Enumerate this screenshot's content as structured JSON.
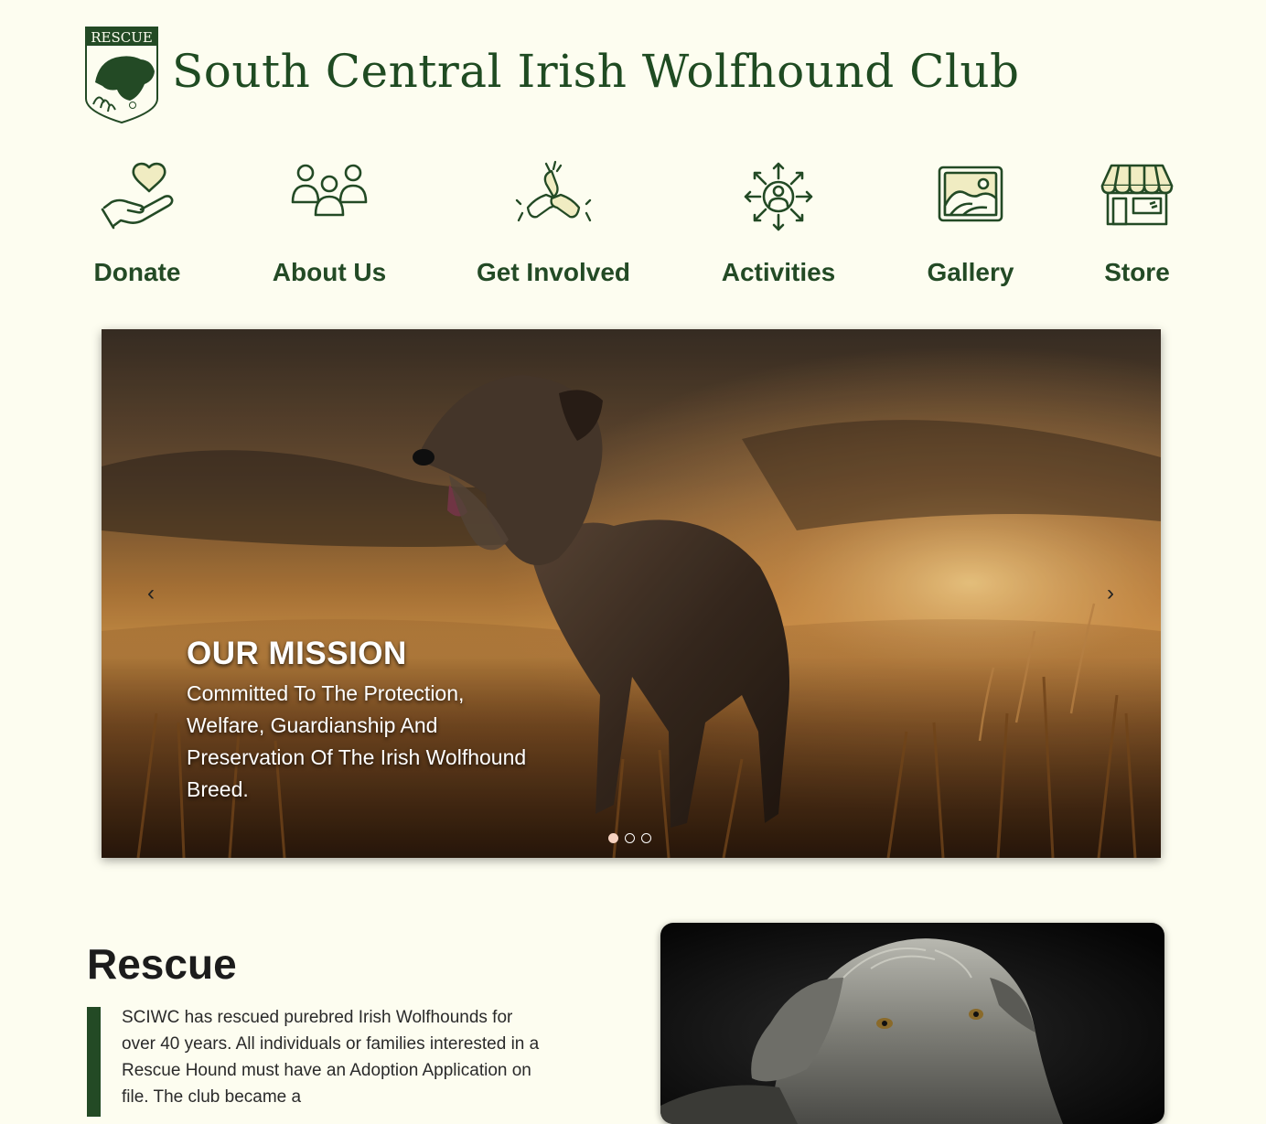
{
  "site": {
    "title": "South Central Irish Wolfhound Club",
    "logo_badge_text": "RESCUE"
  },
  "nav": [
    {
      "label": "Donate",
      "icon": "heart-hand-icon"
    },
    {
      "label": "About Us",
      "icon": "people-group-icon"
    },
    {
      "label": "Get Involved",
      "icon": "hands-together-icon"
    },
    {
      "label": "Activities",
      "icon": "person-arrows-icon"
    },
    {
      "label": "Gallery",
      "icon": "picture-frame-icon"
    },
    {
      "label": "Store",
      "icon": "storefront-icon"
    }
  ],
  "carousel": {
    "slide_title": "OUR MISSION",
    "slide_text": "Committed To The Protection, Welfare, Guardianship And Preservation Of The Irish Wolfhound Breed.",
    "prev_symbol": "‹",
    "next_symbol": "›",
    "slide_count": 3,
    "active_slide": 1
  },
  "rescue": {
    "heading": "Rescue",
    "text": "SCIWC has rescued purebred Irish Wolfhounds for over 40 years. All individuals or families interested in a Rescue Hound must have an Adoption Application on file. The club became a"
  },
  "colors": {
    "background": "#fdfdf0",
    "brand_green": "#234a25",
    "heading_dark": "#1c1c1c",
    "dot_active": "#f6d2c0"
  }
}
